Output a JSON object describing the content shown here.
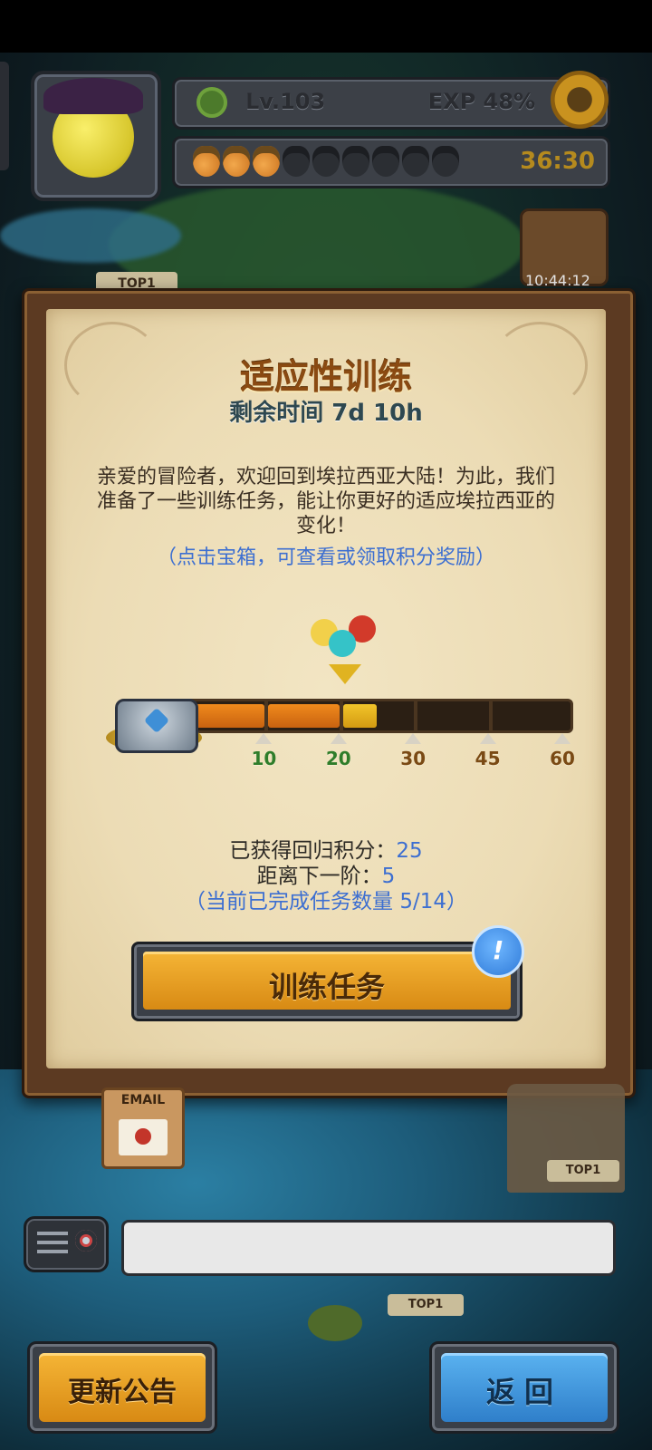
{
  "hud": {
    "level": "Lv.103",
    "exp": "EXP 48%",
    "timer": "36:30",
    "acorns_total": 9,
    "acorns_filled": 3,
    "chest_timer": "10:44:12",
    "top_tag": "TOP1"
  },
  "dialog": {
    "title": "适应性训练",
    "remaining": "剩余时间 7d 10h",
    "description": "亲爱的冒险者，欢迎回到埃拉西亚大陆！为此，我们准备了一些训练任务，能让你更好的适应埃拉西亚的变化！",
    "hint": "（点击宝箱，可查看或领取积分奖励）",
    "progress": {
      "current_points": 25,
      "max_points": 60,
      "milestones": [
        {
          "value": "10",
          "reached": true
        },
        {
          "value": "20",
          "reached": true
        },
        {
          "value": "30",
          "reached": false
        },
        {
          "value": "45",
          "reached": false
        },
        {
          "value": "60",
          "reached": false
        }
      ]
    },
    "points_label": "已获得回归积分：",
    "points_value": "25",
    "next_label": "距离下一阶：",
    "next_value": "5",
    "tasks_note": "（当前已完成任务数量 5/14）",
    "train_button": "训练任务",
    "badge": "!"
  },
  "map": {
    "mail_label": "EMAIL",
    "top_tag_2": "TOP1",
    "top_tag_3": "TOP1"
  },
  "footer": {
    "notice_button": "更新公告",
    "back_button": "返回"
  },
  "colors": {
    "title": "#8a4a12",
    "hint_blue": "#3d6fd1",
    "reached_green": "#2f7d2a",
    "unreached_brown": "#7a4a14",
    "progress_orange": "#f08a1c",
    "progress_yellow": "#f2c52a"
  },
  "icons": [
    "gear-icon",
    "clover-icon",
    "acorn-icon",
    "chest-icon",
    "mail-icon",
    "chat-icon",
    "alert-badge-icon"
  ]
}
